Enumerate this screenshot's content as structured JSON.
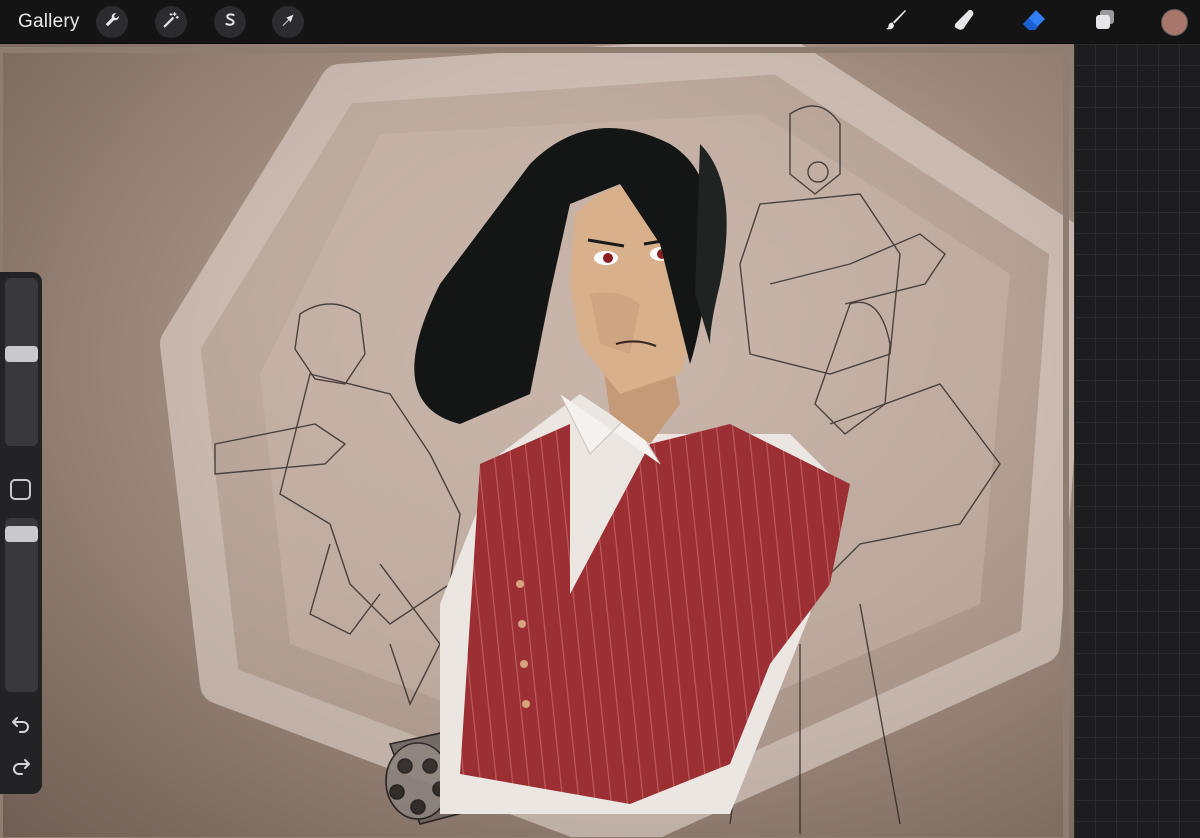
{
  "app": {
    "gallery_label": "Gallery"
  },
  "toolbar": {
    "left_tools": [
      {
        "name": "actions",
        "icon": "wrench-icon"
      },
      {
        "name": "adjustments",
        "icon": "magic-wand-icon"
      },
      {
        "name": "selection",
        "icon": "selection-s-icon"
      },
      {
        "name": "transform",
        "icon": "arrow-cursor-icon"
      }
    ],
    "right_tools": [
      {
        "name": "brush",
        "icon": "brush-icon",
        "active": false
      },
      {
        "name": "smudge",
        "icon": "smudge-finger-icon",
        "active": false
      },
      {
        "name": "eraser",
        "icon": "eraser-icon",
        "active": true
      },
      {
        "name": "layers",
        "icon": "layers-icon",
        "active": false
      }
    ],
    "current_color": "#a8766a",
    "accent_color": "#2f7ef5"
  },
  "sidebar": {
    "brush_size": 0.55,
    "brush_opacity": 0.95,
    "undo_icon": "undo-icon",
    "redo_icon": "redo-icon",
    "modify_icon": "square-modify-icon"
  }
}
